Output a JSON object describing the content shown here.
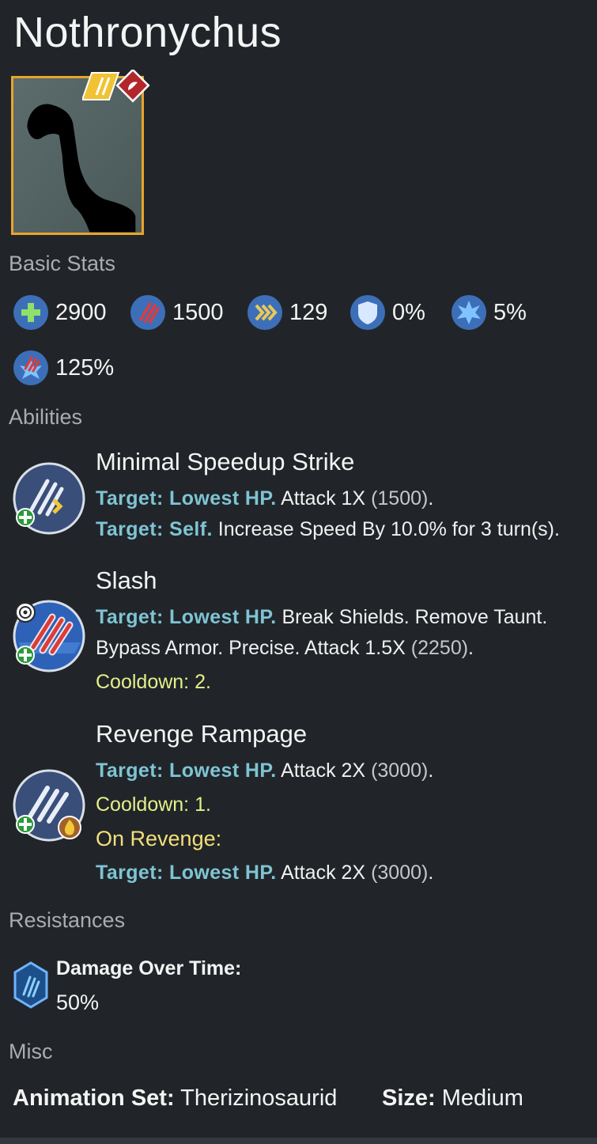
{
  "creature": {
    "name": "Nothronychus"
  },
  "sections": {
    "basic_stats": "Basic Stats",
    "abilities": "Abilities",
    "resistances": "Resistances",
    "misc": "Misc"
  },
  "stats": [
    {
      "icon": "health-icon",
      "value": "2900"
    },
    {
      "icon": "damage-icon",
      "value": "1500"
    },
    {
      "icon": "speed-icon",
      "value": "129"
    },
    {
      "icon": "armor-icon",
      "value": "0%"
    },
    {
      "icon": "crit-chance-icon",
      "value": "5%"
    },
    {
      "icon": "crit-multiplier-icon",
      "value": "125%"
    }
  ],
  "abilities": [
    {
      "name": "Minimal Speedup Strike",
      "lines": [
        {
          "target": "Target: Lowest HP.",
          "text": " Attack 1X ",
          "value": "(1500)",
          "end": "."
        },
        {
          "target": "Target: Self.",
          "text": " Increase Speed By 10.0% for 3 turn(s)."
        }
      ]
    },
    {
      "name": "Slash",
      "lines": [
        {
          "target": "Target: Lowest HP.",
          "text": " Break Shields. Remove Taunt."
        },
        {
          "text": "Bypass Armor. Precise. Attack 1.5X ",
          "value": "(2250)",
          "end": "."
        }
      ],
      "cooldown": "Cooldown: 2."
    },
    {
      "name": "Revenge Rampage",
      "lines": [
        {
          "target": "Target: Lowest HP.",
          "text": " Attack 2X ",
          "value": "(3000)",
          "end": "."
        }
      ],
      "cooldown": "Cooldown: 1.",
      "revenge_label": "On Revenge:",
      "revenge_lines": [
        {
          "target": "Target: Lowest HP.",
          "text": " Attack 2X ",
          "value": "(3000)",
          "end": "."
        }
      ]
    }
  ],
  "resistances": [
    {
      "name": "Damage Over Time:",
      "value": "50%"
    }
  ],
  "misc": {
    "animation_label": "Animation Set:",
    "animation_value": " Therizinosaurid",
    "size_label": "Size:",
    "size_value": " Medium"
  },
  "colors": {
    "background": "#212529",
    "target": "#7ec4d4",
    "cooldown": "#e4ef8c",
    "rarity_border": "#e8a52a"
  }
}
